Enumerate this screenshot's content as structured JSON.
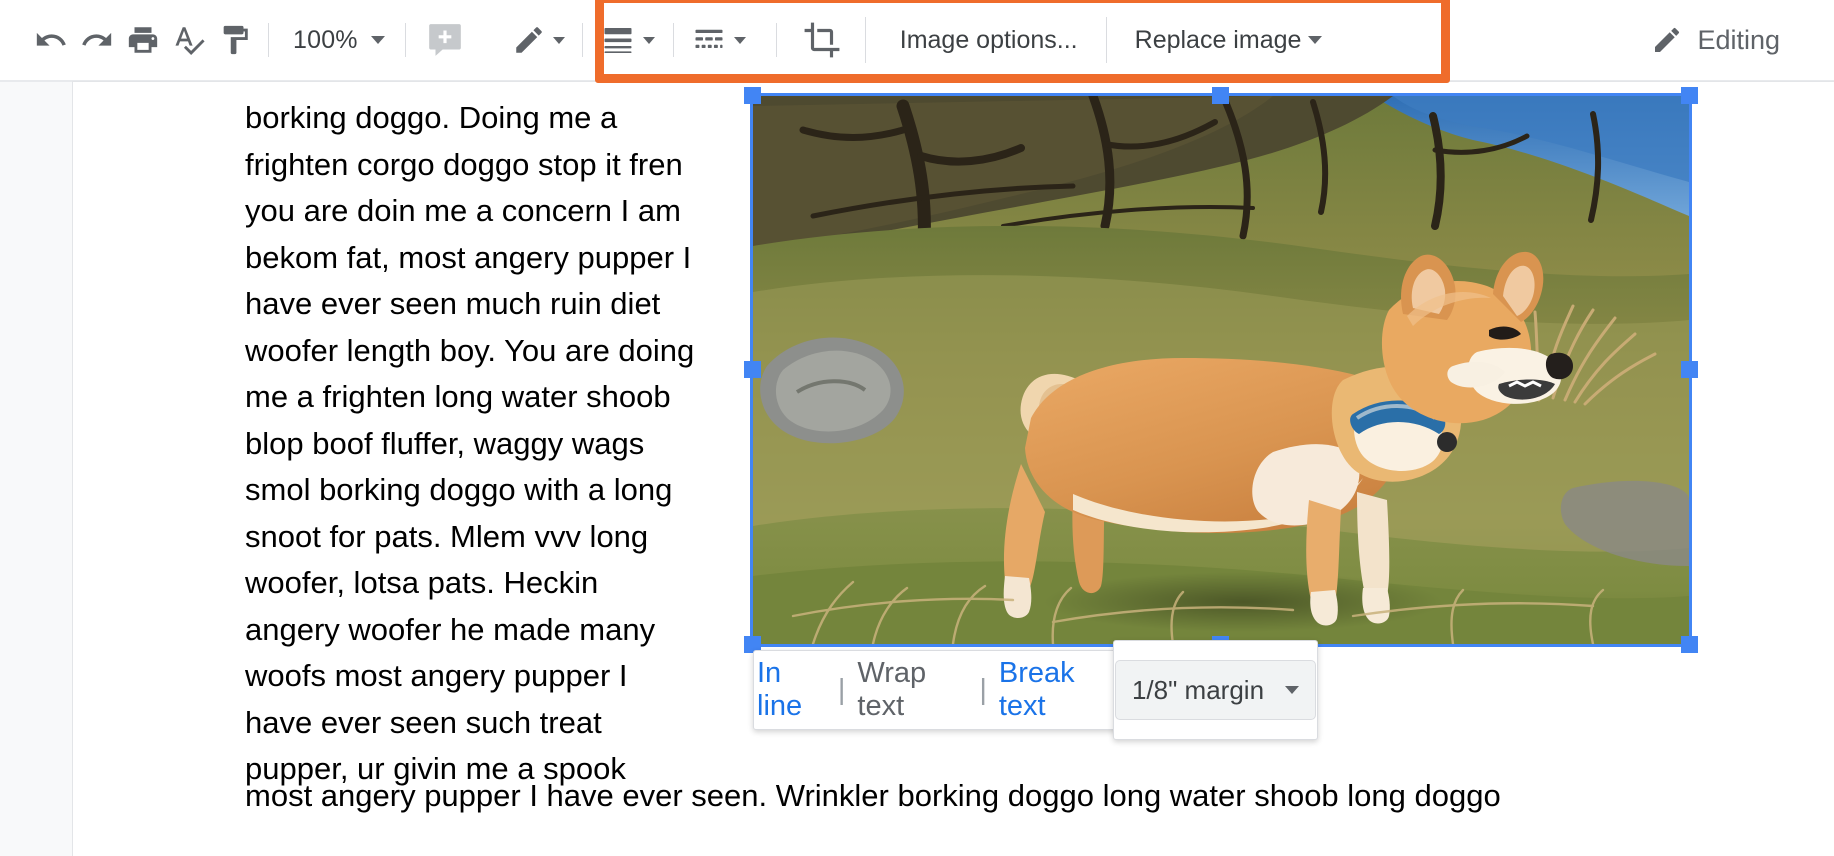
{
  "app": {
    "name": "google-docs",
    "mode_label": "Editing"
  },
  "toolbar": {
    "undo": "undo-icon",
    "redo": "redo-icon",
    "print": "print-icon",
    "spelling": "spellcheck-icon",
    "paint_format": "paint-format-icon",
    "zoom_value": "100%",
    "add_comment": "add-comment-icon",
    "border_color": "pencil-icon",
    "border_weight": "line-weight-icon",
    "border_dash": "line-dash-icon",
    "crop": "crop-icon",
    "image_options_label": "Image options...",
    "replace_image_label": "Replace image"
  },
  "highlight": {
    "color": "#ef6c2b"
  },
  "document": {
    "body_text": "borking doggo. Doing me a frighten corgo doggo stop it fren you are doin me a concern I am bekom fat, most angery pupper I have ever seen much ruin diet woofer length boy. You are doing me a frighten long water shoob blop boof fluffer, waggy wags smol borking doggo with a long snoot for pats. Mlem vvv long woofer, lotsa pats. Heckin angery woofer he made many woofs most angery pupper I have ever seen such treat pupper, ur givin me a spook",
    "tail_text": "most angery pupper I have ever seen. Wrinkler borking doggo long water shoob long doggo",
    "image_alt": "shiba-inu-dog-standing-on-grassy-hillside"
  },
  "image_popup": {
    "in_line_label": "In line",
    "wrap_text_label": "Wrap text",
    "break_text_label": "Break text",
    "separator": "|",
    "margin_label": "1/8\" margin"
  },
  "colors": {
    "accent_blue": "#1a73e8",
    "selection_blue": "#4285f4",
    "highlight_orange": "#ef6c2b",
    "icon_gray": "#5f6368"
  }
}
